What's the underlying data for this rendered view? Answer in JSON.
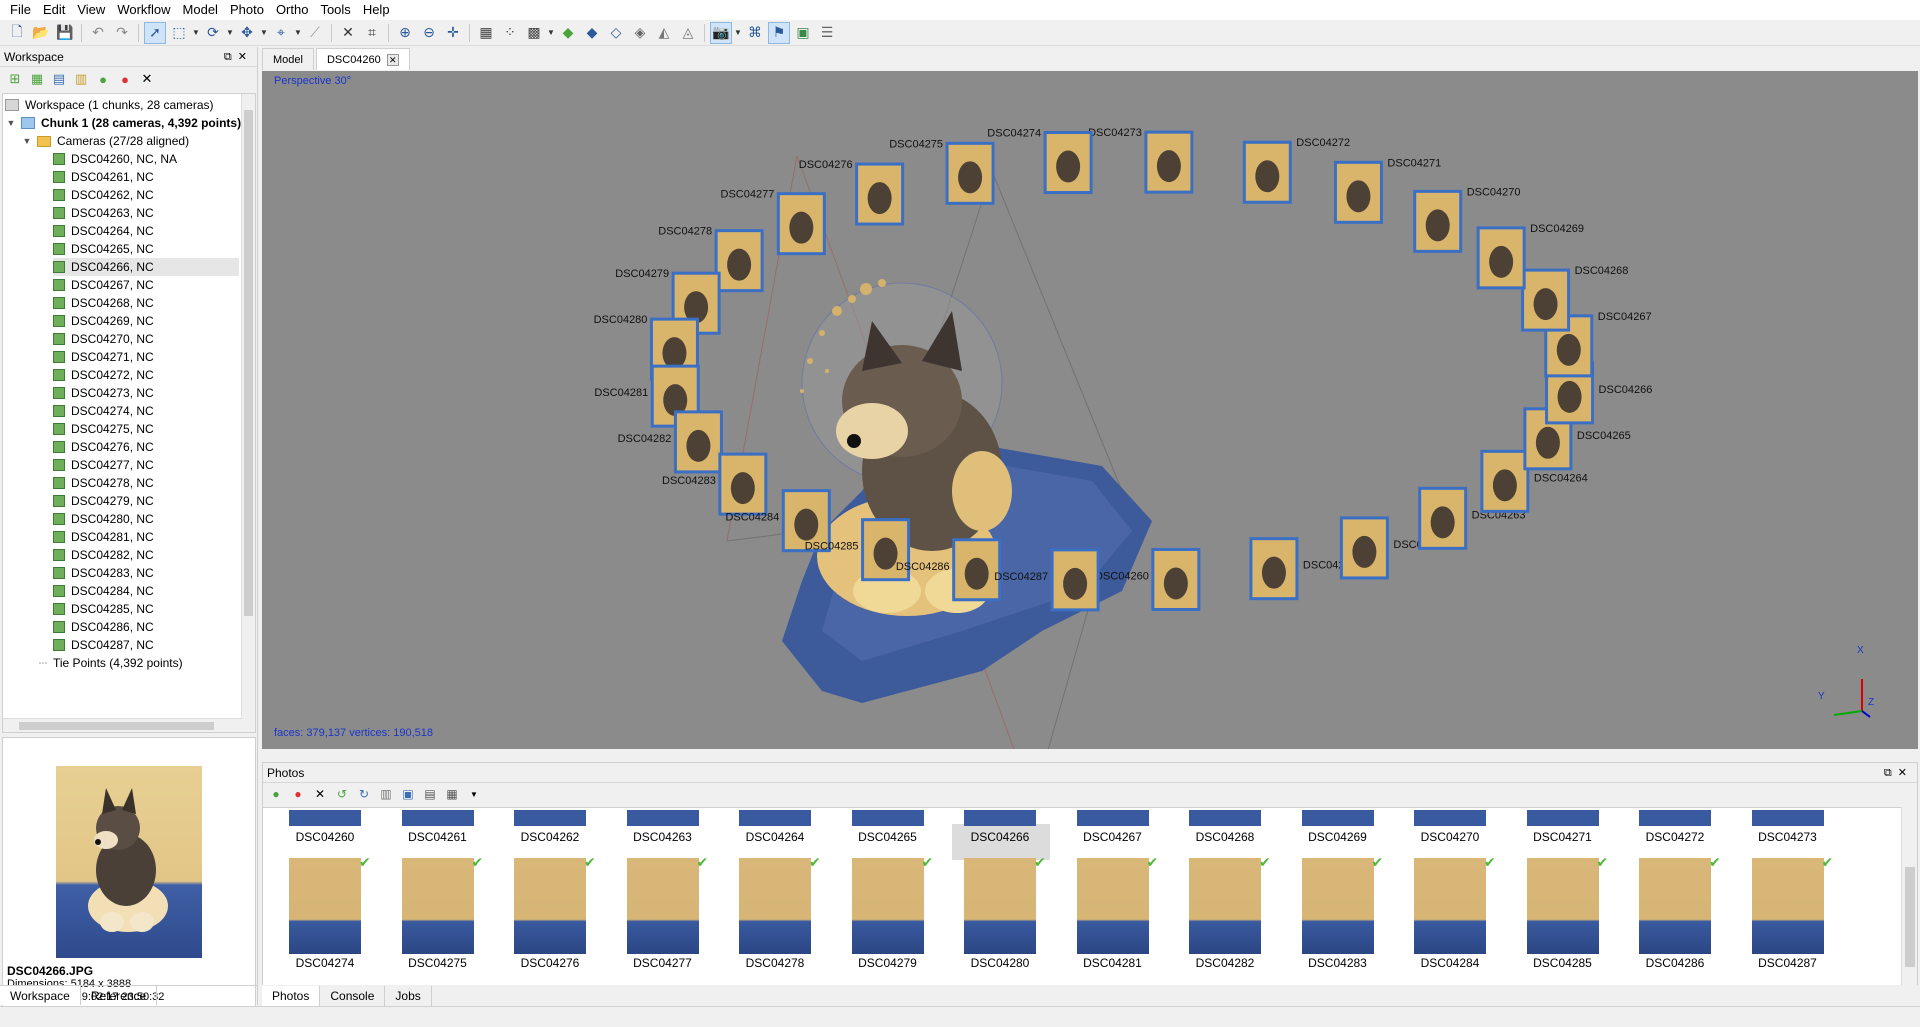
{
  "menu": [
    "File",
    "Edit",
    "View",
    "Workflow",
    "Model",
    "Photo",
    "Ortho",
    "Tools",
    "Help"
  ],
  "workspace": {
    "title": "Workspace",
    "root": "Workspace (1 chunks, 28 cameras)",
    "chunk": "Chunk 1 (28 cameras, 4,392 points)",
    "cameras_folder": "Cameras (27/28 aligned)",
    "cameras": [
      "DSC04260, NC, NA",
      "DSC04261, NC",
      "DSC04262, NC",
      "DSC04263, NC",
      "DSC04264, NC",
      "DSC04265, NC",
      "DSC04266, NC",
      "DSC04267, NC",
      "DSC04268, NC",
      "DSC04269, NC",
      "DSC04270, NC",
      "DSC04271, NC",
      "DSC04272, NC",
      "DSC04273, NC",
      "DSC04274, NC",
      "DSC04275, NC",
      "DSC04276, NC",
      "DSC04277, NC",
      "DSC04278, NC",
      "DSC04279, NC",
      "DSC04280, NC",
      "DSC04281, NC",
      "DSC04282, NC",
      "DSC04283, NC",
      "DSC04284, NC",
      "DSC04285, NC",
      "DSC04286, NC",
      "DSC04287, NC"
    ],
    "selected_index": 6,
    "tie_points": "Tie Points (4,392 points)"
  },
  "preview": {
    "filename": "DSC04266.JPG",
    "dimensions": "Dimensions: 5184 x 3888",
    "datetime": "Date/Time: 2019:02:17 23:50:32"
  },
  "left_tabs": [
    "Workspace",
    "Reference"
  ],
  "viewport": {
    "tabs": [
      "Model",
      "DSC04260"
    ],
    "projection": "Perspective 30°",
    "stats": "faces: 379,137 vertices: 190,518",
    "axis": {
      "x": "X",
      "y": "Y",
      "z": "Z"
    },
    "camera_labels": [
      "DSC04260",
      "DSC04261",
      "DSC04262",
      "DSC04263",
      "DSC04264",
      "DSC04265",
      "DSC04266",
      "DSC04267",
      "DSC04268",
      "DSC04269",
      "DSC04270",
      "DSC04271",
      "DSC04272",
      "DSC04273",
      "DSC04274",
      "DSC04275",
      "DSC04276",
      "DSC04277",
      "DSC04278",
      "DSC04279",
      "DSC04280",
      "DSC04281",
      "DSC04282",
      "DSC04283",
      "DSC04284",
      "DSC04285",
      "DSC04286",
      "DSC04287"
    ]
  },
  "photos": {
    "title": "Photos",
    "row1": [
      "DSC04260",
      "DSC04261",
      "DSC04262",
      "DSC04263",
      "DSC04264",
      "DSC04265",
      "DSC04266",
      "DSC04267",
      "DSC04268",
      "DSC04269",
      "DSC04270",
      "DSC04271",
      "DSC04272",
      "DSC04273"
    ],
    "row2": [
      "DSC04274",
      "DSC04275",
      "DSC04276",
      "DSC04277",
      "DSC04278",
      "DSC04279",
      "DSC04280",
      "DSC04281",
      "DSC04282",
      "DSC04283",
      "DSC04284",
      "DSC04285",
      "DSC04286",
      "DSC04287"
    ],
    "selected": "DSC04266"
  },
  "bottom_tabs": [
    "Photos",
    "Console",
    "Jobs"
  ],
  "colors": {
    "viewport_bg": "#8b8b8b",
    "label_blue": "#1a37c9",
    "check_green": "#52b83b",
    "mesh_blue": "#3d5a9a"
  }
}
